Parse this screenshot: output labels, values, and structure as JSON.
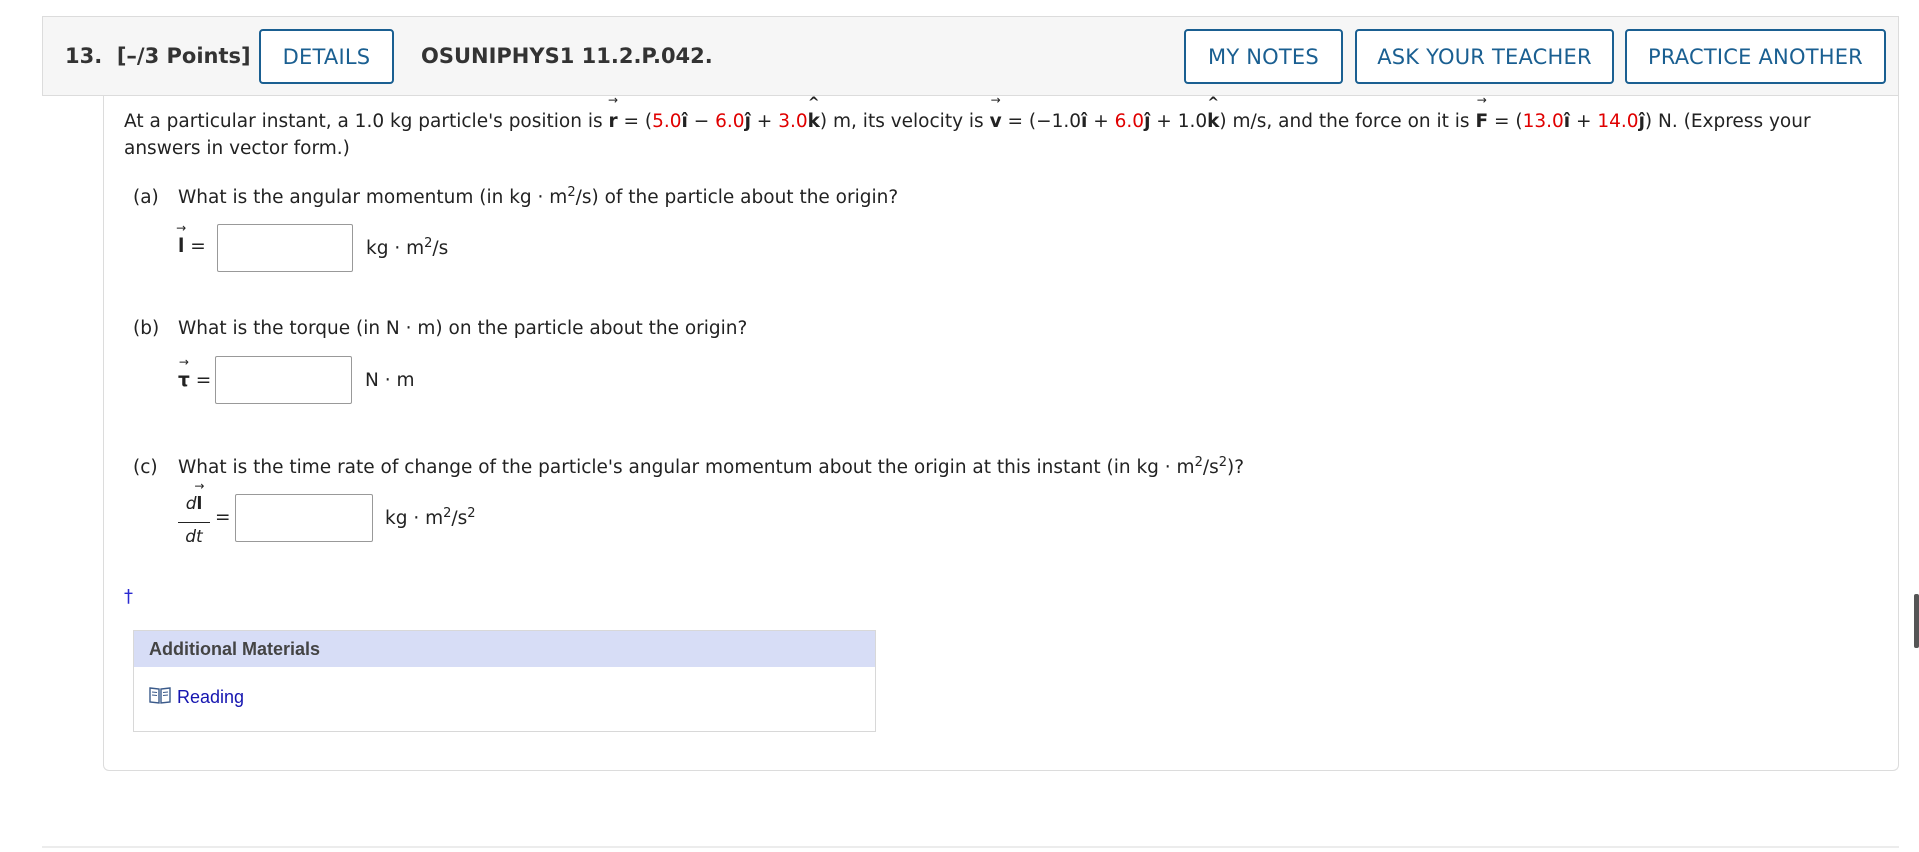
{
  "header": {
    "question_number": "13.",
    "points": "[–/3 Points]",
    "details_label": "DETAILS",
    "question_code": "OSUNIPHYS1 11.2.P.042.",
    "my_notes_label": "MY NOTES",
    "ask_teacher_label": "ASK YOUR TEACHER",
    "practice_label": "PRACTICE ANOTHER"
  },
  "prompt": {
    "text_1": "At a particular instant, a 1.0 kg particle's position is ",
    "r_symbol": "r",
    "eq_open": " = (",
    "r_x": "5.0",
    "r_y": "6.0",
    "r_z": "3.0",
    "unit_m": ") m, its velocity is ",
    "v_symbol": "v",
    "v_x": "−1.0",
    "v_y": "6.0",
    "v_z": "1.0",
    "unit_ms": ") m/s, and the force on it is ",
    "f_symbol": "F",
    "f_x": "13.0",
    "f_y": "14.0",
    "text_end": ") N. (Express your answers in vector form.)"
  },
  "parts": [
    {
      "label": "(a)",
      "question": "What is the angular momentum (in kg · m",
      "question_sup": "2",
      "question_end": "/s) of the particle about the origin?",
      "answer_symbol": "l",
      "units": "kg · m",
      "units_sup": "2",
      "units_end": "/s"
    },
    {
      "label": "(b)",
      "question": "What is the torque (in N · m) on the particle about the origin?",
      "answer_symbol": "τ",
      "units": "N · m"
    },
    {
      "label": "(c)",
      "question": "What is the time rate of change of the particle's angular momentum about the origin at this instant (in kg · m",
      "question_sup": "2",
      "question_mid": "/s",
      "question_sup2": "2",
      "question_end": ")?",
      "answer_num_d": "d",
      "answer_num_symbol": "l",
      "answer_den": "dt",
      "units": "kg · m",
      "units_sup": "2",
      "units_mid": "/s",
      "units_sup2": "2"
    }
  ],
  "dagger": "†",
  "materials": {
    "title": "Additional Materials",
    "link_label": "Reading",
    "icon": "book-icon"
  },
  "colors": {
    "accent": "#1a5f91",
    "given_value": "#e00000",
    "materials_header": "#d7ddf6",
    "link": "#1515b0"
  }
}
